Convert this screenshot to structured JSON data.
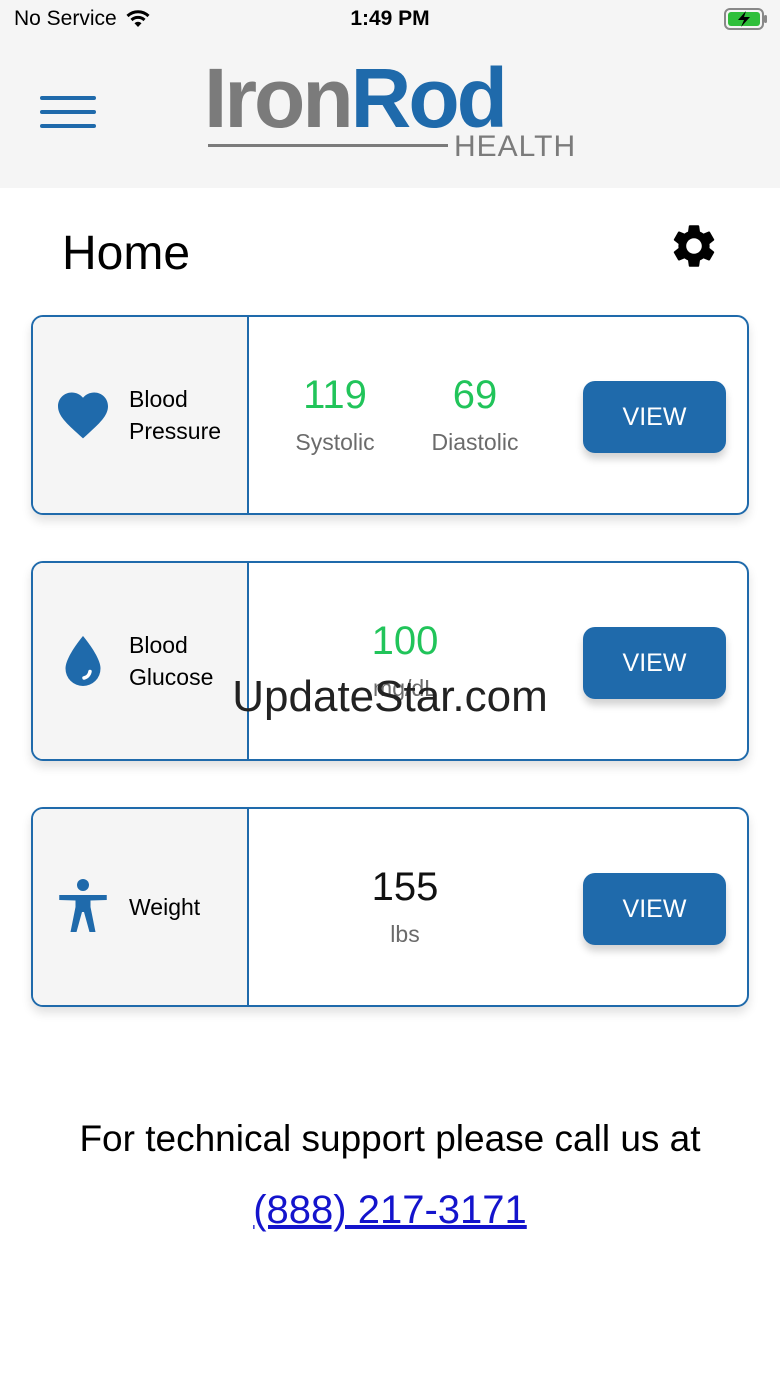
{
  "status_bar": {
    "carrier": "No Service",
    "time": "1:49 PM"
  },
  "header": {
    "logo_word1": "Iron",
    "logo_word2": "Rod",
    "logo_sub": "HEALTH"
  },
  "page": {
    "title": "Home"
  },
  "cards": {
    "bp": {
      "label": "Blood\nPressure",
      "systolic_value": "119",
      "systolic_label": "Systolic",
      "diastolic_value": "69",
      "diastolic_label": "Diastolic",
      "button": "VIEW"
    },
    "glucose": {
      "label": "Blood\nGlucose",
      "value": "100",
      "unit": "mg/dL",
      "button": "VIEW"
    },
    "weight": {
      "label": "Weight",
      "value": "155",
      "unit": "lbs",
      "button": "VIEW"
    }
  },
  "watermark": "UpdateStar.com",
  "support": {
    "text": "For technical support please call us at",
    "phone": "(888) 217-3171"
  },
  "colors": {
    "brand": "#1f6aab",
    "reading_green": "#21c45a",
    "gray": "#7b7b7b"
  }
}
